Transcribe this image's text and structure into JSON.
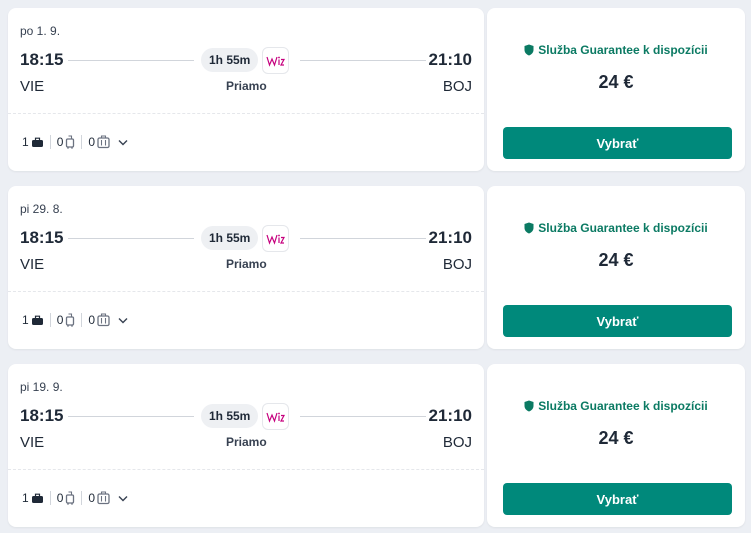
{
  "flights": [
    {
      "date": "po 1. 9.",
      "dep_time": "18:15",
      "arr_time": "21:10",
      "duration": "1h 55m",
      "dep_code": "VIE",
      "arr_code": "BOJ",
      "stops": "Priamo",
      "bags": {
        "personal": "1",
        "cabin": "0",
        "checked": "0"
      },
      "guarantee": "Služba Guarantee k dispozícii",
      "price": "24 €",
      "select_label": "Vybrať"
    },
    {
      "date": "pi 29. 8.",
      "dep_time": "18:15",
      "arr_time": "21:10",
      "duration": "1h 55m",
      "dep_code": "VIE",
      "arr_code": "BOJ",
      "stops": "Priamo",
      "bags": {
        "personal": "1",
        "cabin": "0",
        "checked": "0"
      },
      "guarantee": "Služba Guarantee k dispozícii",
      "price": "24 €",
      "select_label": "Vybrať"
    },
    {
      "date": "pi 19. 9.",
      "dep_time": "18:15",
      "arr_time": "21:10",
      "duration": "1h 55m",
      "dep_code": "VIE",
      "arr_code": "BOJ",
      "stops": "Priamo",
      "bags": {
        "personal": "1",
        "cabin": "0",
        "checked": "0"
      },
      "guarantee": "Služba Guarantee k dispozícii",
      "price": "24 €",
      "select_label": "Vybrať"
    }
  ],
  "icons": {
    "carrier": "wizzair-logo-icon",
    "personal_bag": "personal-item-icon",
    "cabin_bag": "cabin-bag-icon",
    "checked_bag": "checked-bag-icon",
    "expand": "chevron-down-icon",
    "guarantee": "shield-icon"
  },
  "colors": {
    "accent": "#00897b",
    "guarantee_text": "#0b7a63",
    "background": "#eceff4"
  }
}
